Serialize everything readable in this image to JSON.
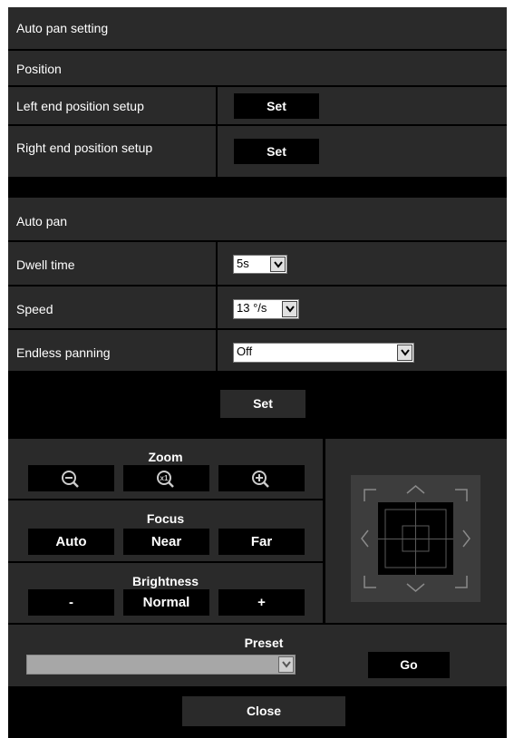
{
  "header": {
    "title": "Auto pan setting"
  },
  "position": {
    "section_label": "Position",
    "left_label": "Left end position setup",
    "left_button": "Set",
    "right_label": "Right end position setup",
    "right_button": "Set"
  },
  "autopan": {
    "section_label": "Auto pan",
    "dwell_label": "Dwell time",
    "dwell_value": "5s",
    "speed_label": "Speed",
    "speed_value": "13 °/s",
    "endless_label": "Endless panning",
    "endless_value": "Off",
    "set_button": "Set"
  },
  "controls": {
    "zoom_label": "Zoom",
    "zoom_x1_text": "x1",
    "focus_label": "Focus",
    "focus_auto": "Auto",
    "focus_near": "Near",
    "focus_far": "Far",
    "brightness_label": "Brightness",
    "brightness_minus": "-",
    "brightness_normal": "Normal",
    "brightness_plus": "+"
  },
  "preset": {
    "label": "Preset",
    "value": "",
    "go_button": "Go"
  },
  "footer": {
    "close_button": "Close"
  },
  "icons": {
    "zoom_out": "zoom-out-icon",
    "zoom_x1": "zoom-x1-icon",
    "zoom_in": "zoom-in-icon",
    "dropdown": "chevron-down-icon"
  },
  "colors": {
    "background": "#000000",
    "row": "#2a2a2a",
    "text": "#ffffff",
    "dpad_tile": "#3d3d3d",
    "dpad_center": "#000000"
  }
}
